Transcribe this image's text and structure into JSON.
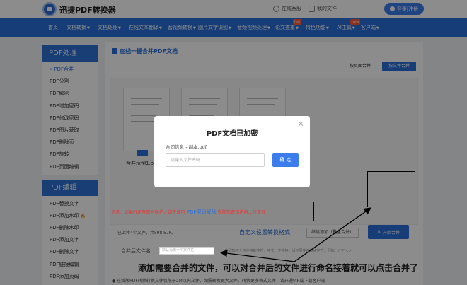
{
  "header": {
    "brand": "迅捷PDF转换器",
    "links": [
      "在线客服",
      "我的文件"
    ],
    "login": "登录|注册"
  },
  "nav": {
    "items": [
      {
        "label": "首页",
        "caret": false
      },
      {
        "label": "文档转换",
        "caret": true
      },
      {
        "label": "文档处理",
        "caret": true
      },
      {
        "label": "在线文本翻译",
        "caret": true
      },
      {
        "label": "音视频转换",
        "caret": true
      },
      {
        "label": "图片文字识别",
        "caret": true
      },
      {
        "label": "音频视频处理",
        "caret": true
      },
      {
        "label": "论文查重",
        "caret": true,
        "badge": "hot"
      },
      {
        "label": "特色功能",
        "caret": true
      },
      {
        "label": "AI工具",
        "caret": true,
        "badge": "new"
      },
      {
        "label": "客户端",
        "caret": true
      }
    ]
  },
  "sidebar": {
    "section1": "PDF处理",
    "items1": [
      "PDF合并",
      "PDF分割",
      "PDF解密",
      "PDF增加密码",
      "PDF修改密码",
      "PDF图片获取",
      "PDF删除页",
      "PDF旋转",
      "PDF页面编辑"
    ],
    "section2": "PDF编辑",
    "items2": [
      "PDF替换文字",
      "PDF添加水印",
      "PDF删除水印",
      "PDF添加文字",
      "PDF删除文字",
      "PDF链接编辑",
      "PDF添加页码"
    ]
  },
  "main": {
    "title": "在线一键合并PDF文档",
    "sort_btn": "按页面合并",
    "add_btn": "按文件合并",
    "file_name": "合并示例1.p...",
    "count_text": "已上传4个文件，共598.57K。",
    "continue_btn": "继续添加（批量合并）",
    "start_btn": "开始合并",
    "notice": "注意：如果PDF有密码保护，请先使用",
    "notice_link": "PDF密码解除",
    "notice_tail": "去除加密保护再上传文件",
    "custom_title": "自定义设置转换格式",
    "name_label": "合并后文件名",
    "name_placeholder": "默认为第一个文件名",
    "rule_text": "·中间如不允许使用的字符，中文、空字格，请不要使用特殊字符，例如：/:*?\"<>|",
    "footnote": "● 在线版PDF转换转换文件仅限于2M以内文件，如需转换更大文件、转换更多格式文件，请开通VIP或下载客户端"
  },
  "modal": {
    "title": "PDF文档已加密",
    "close": "×",
    "file": "合同信息 - 副本.pdf",
    "input_placeholder": "请输入文件密码",
    "ok": "确 定"
  },
  "caption": "添加需要合并的文件，可以对合并后的文件进行命名接着就可以点击合并了"
}
